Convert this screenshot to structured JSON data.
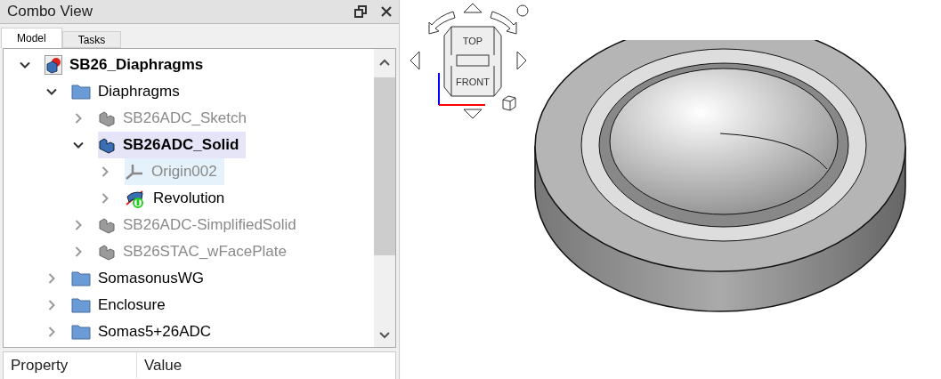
{
  "panel": {
    "title": "Combo View"
  },
  "tabs": [
    {
      "label": "Model",
      "selected": true
    },
    {
      "label": "Tasks",
      "selected": false
    }
  ],
  "tree": [
    {
      "label": "SB26_Diaphragms",
      "kind": "document",
      "expanded": true,
      "bold": true,
      "active": false,
      "selected": false,
      "dimmed": false,
      "children": [
        {
          "label": "Diaphragms",
          "kind": "folder",
          "expanded": true,
          "bold": false,
          "active": false,
          "selected": false,
          "dimmed": false,
          "children": [
            {
              "label": "SB26ADC_Sketch",
              "kind": "body",
              "expanded": false,
              "bold": false,
              "active": false,
              "selected": false,
              "dimmed": true
            },
            {
              "label": "SB26ADC_Solid",
              "kind": "body",
              "expanded": true,
              "bold": true,
              "active": true,
              "selected": false,
              "dimmed": false,
              "children": [
                {
                  "label": "Origin002",
                  "kind": "origin",
                  "expanded": false,
                  "bold": false,
                  "active": false,
                  "selected": true,
                  "dimmed": true
                },
                {
                  "label": "Revolution",
                  "kind": "revolution",
                  "expanded": false,
                  "bold": false,
                  "active": false,
                  "selected": false,
                  "dimmed": false
                }
              ]
            },
            {
              "label": "SB26ADC-SimplifiedSolid",
              "kind": "body",
              "expanded": false,
              "bold": false,
              "active": false,
              "selected": false,
              "dimmed": true
            },
            {
              "label": "SB26STAC_wFacePlate",
              "kind": "body",
              "expanded": false,
              "bold": false,
              "active": false,
              "selected": false,
              "dimmed": true
            }
          ]
        },
        {
          "label": "SomasonusWG",
          "kind": "folder",
          "expanded": false,
          "bold": false,
          "active": false,
          "selected": false,
          "dimmed": false
        },
        {
          "label": "Enclosure",
          "kind": "folder",
          "expanded": false,
          "bold": false,
          "active": false,
          "selected": false,
          "dimmed": false
        },
        {
          "label": "Somas5+26ADC",
          "kind": "folder",
          "expanded": false,
          "bold": false,
          "active": false,
          "selected": false,
          "dimmed": false
        }
      ]
    }
  ],
  "properties": {
    "columns": [
      "Property",
      "Value"
    ]
  },
  "nav_cube": {
    "faces": [
      "TOP",
      "FRONT"
    ]
  }
}
